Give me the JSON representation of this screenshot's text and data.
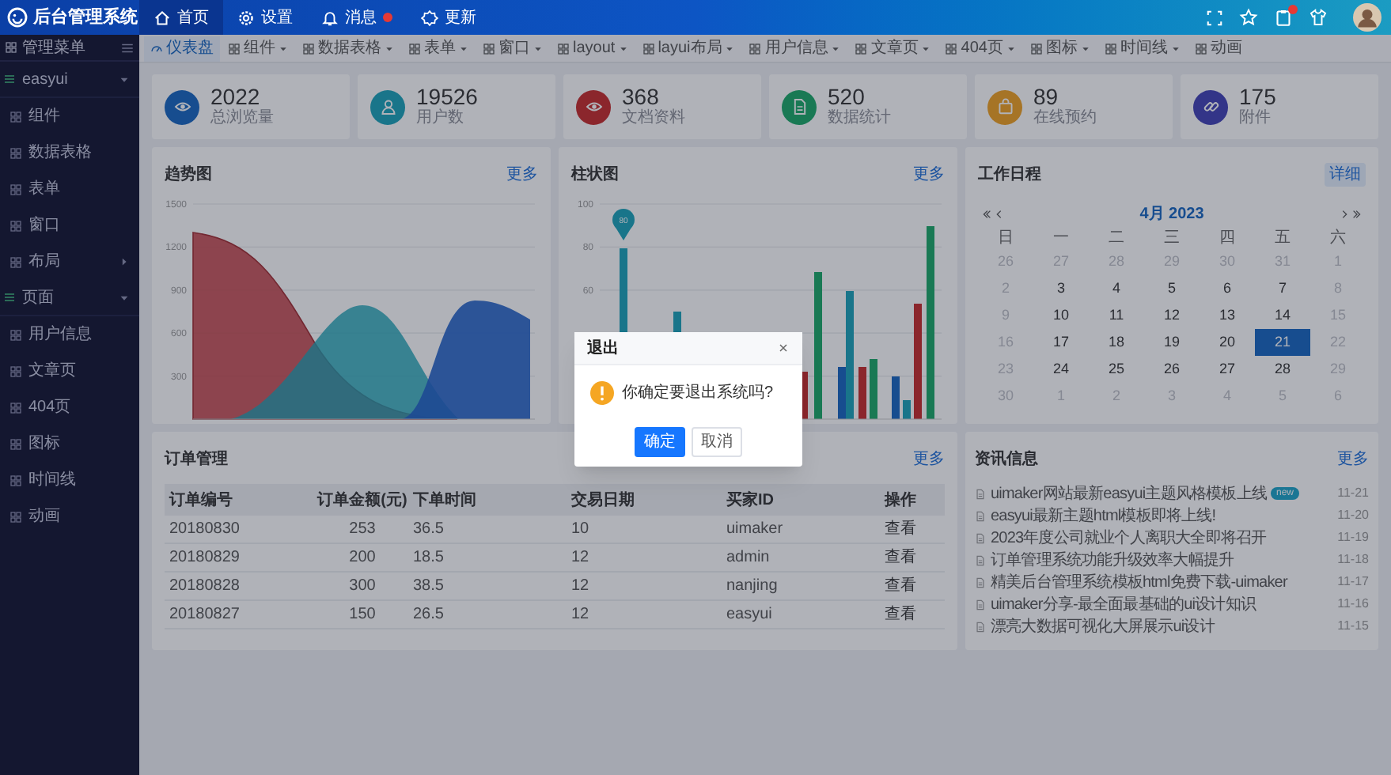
{
  "top_bar": {
    "title": "后台管理系统",
    "nav": [
      {
        "label": "首页",
        "selected": true,
        "badge": false
      },
      {
        "label": "设置",
        "selected": false,
        "badge": false
      },
      {
        "label": "消息",
        "selected": false,
        "badge": true
      },
      {
        "label": "更新",
        "selected": false,
        "badge": false
      }
    ],
    "notification_badge": true
  },
  "sidebar": {
    "title": "管理菜单",
    "items": [
      {
        "label": "easyui",
        "expanded": true,
        "children": [
          {
            "label": "组件"
          },
          {
            "label": "数据表格"
          },
          {
            "label": "表单"
          },
          {
            "label": "窗口"
          },
          {
            "label": "布局",
            "expanded": false
          }
        ]
      },
      {
        "label": "页面",
        "expanded": true,
        "children": [
          {
            "label": "用户信息"
          },
          {
            "label": "文章页"
          },
          {
            "label": "404页"
          },
          {
            "label": "图标"
          },
          {
            "label": "时间线"
          },
          {
            "label": "动画"
          }
        ]
      }
    ]
  },
  "tabs": [
    {
      "label": "仪表盘",
      "selected": true,
      "dropdown": false
    },
    {
      "label": "组件",
      "selected": false,
      "dropdown": true
    },
    {
      "label": "数据表格",
      "selected": false,
      "dropdown": true
    },
    {
      "label": "表单",
      "selected": false,
      "dropdown": true
    },
    {
      "label": "窗口",
      "selected": false,
      "dropdown": true
    },
    {
      "label": "layout",
      "selected": false,
      "dropdown": true
    },
    {
      "label": "layui布局",
      "selected": false,
      "dropdown": true
    },
    {
      "label": "用户信息",
      "selected": false,
      "dropdown": true
    },
    {
      "label": "文章页",
      "selected": false,
      "dropdown": true
    },
    {
      "label": "404页",
      "selected": false,
      "dropdown": true
    },
    {
      "label": "图标",
      "selected": false,
      "dropdown": true
    },
    {
      "label": "时间线",
      "selected": false,
      "dropdown": true
    },
    {
      "label": "动画",
      "selected": false,
      "dropdown": false
    }
  ],
  "stats": [
    {
      "value": "2022",
      "label": "总浏览量"
    },
    {
      "value": "19526",
      "label": "用户数"
    },
    {
      "value": "368",
      "label": "文档资料"
    },
    {
      "value": "520",
      "label": "数据统计"
    },
    {
      "value": "89",
      "label": "在线预约"
    },
    {
      "value": "175",
      "label": "附件"
    }
  ],
  "trend_chart": {
    "title": "趋势图",
    "more": "更多",
    "y_ticks": [
      "1500",
      "1200",
      "900",
      "600",
      "300"
    ]
  },
  "bar_chart": {
    "title": "柱状图",
    "more": "更多",
    "y_ticks": [
      "100",
      "80",
      "60"
    ],
    "pin_label": "80"
  },
  "calendar": {
    "title": "工作日程",
    "detail": "详细",
    "month": "4月 2023",
    "weekdays": [
      "日",
      "一",
      "二",
      "三",
      "四",
      "五",
      "六"
    ],
    "weeks": [
      [
        {
          "day": "26",
          "muted": true,
          "selected": false
        },
        {
          "day": "27",
          "muted": true,
          "selected": false
        },
        {
          "day": "28",
          "muted": true,
          "selected": false
        },
        {
          "day": "29",
          "muted": true,
          "selected": false
        },
        {
          "day": "30",
          "muted": true,
          "selected": false
        },
        {
          "day": "31",
          "muted": true,
          "selected": false
        },
        {
          "day": "1",
          "muted": true,
          "selected": false
        }
      ],
      [
        {
          "day": "2",
          "muted": true,
          "selected": false
        },
        {
          "day": "3",
          "muted": false,
          "selected": false
        },
        {
          "day": "4",
          "muted": false,
          "selected": false
        },
        {
          "day": "5",
          "muted": false,
          "selected": false
        },
        {
          "day": "6",
          "muted": false,
          "selected": false
        },
        {
          "day": "7",
          "muted": false,
          "selected": false
        },
        {
          "day": "8",
          "muted": true,
          "selected": false
        }
      ],
      [
        {
          "day": "9",
          "muted": true,
          "selected": false
        },
        {
          "day": "10",
          "muted": false,
          "selected": false
        },
        {
          "day": "11",
          "muted": false,
          "selected": false
        },
        {
          "day": "12",
          "muted": false,
          "selected": false
        },
        {
          "day": "13",
          "muted": false,
          "selected": false
        },
        {
          "day": "14",
          "muted": false,
          "selected": false
        },
        {
          "day": "15",
          "muted": true,
          "selected": false
        }
      ],
      [
        {
          "day": "16",
          "muted": true,
          "selected": false
        },
        {
          "day": "17",
          "muted": false,
          "selected": false
        },
        {
          "day": "18",
          "muted": false,
          "selected": false
        },
        {
          "day": "19",
          "muted": false,
          "selected": false
        },
        {
          "day": "20",
          "muted": false,
          "selected": false
        },
        {
          "day": "21",
          "muted": false,
          "selected": true
        },
        {
          "day": "22",
          "muted": true,
          "selected": false
        }
      ],
      [
        {
          "day": "23",
          "muted": true,
          "selected": false
        },
        {
          "day": "24",
          "muted": false,
          "selected": false
        },
        {
          "day": "25",
          "muted": false,
          "selected": false
        },
        {
          "day": "26",
          "muted": false,
          "selected": false
        },
        {
          "day": "27",
          "muted": false,
          "selected": false
        },
        {
          "day": "28",
          "muted": false,
          "selected": false
        },
        {
          "day": "29",
          "muted": true,
          "selected": false
        }
      ],
      [
        {
          "day": "30",
          "muted": true,
          "selected": false
        },
        {
          "day": "1",
          "muted": true,
          "selected": false
        },
        {
          "day": "2",
          "muted": true,
          "selected": false
        },
        {
          "day": "3",
          "muted": true,
          "selected": false
        },
        {
          "day": "4",
          "muted": true,
          "selected": false
        },
        {
          "day": "5",
          "muted": true,
          "selected": false
        },
        {
          "day": "6",
          "muted": true,
          "selected": false
        }
      ]
    ]
  },
  "orders": {
    "title": "订单管理",
    "more": "更多",
    "columns": [
      "订单编号",
      "订单金额(元)",
      "下单时间",
      "交易日期",
      "买家ID",
      "操作"
    ],
    "rows": [
      [
        "20180830",
        "253",
        "36.5",
        "10",
        "uimaker",
        "查看"
      ],
      [
        "20180829",
        "200",
        "18.5",
        "12",
        "admin",
        "查看"
      ],
      [
        "20180828",
        "300",
        "38.5",
        "12",
        "nanjing",
        "查看"
      ],
      [
        "20180827",
        "150",
        "26.5",
        "12",
        "easyui",
        "查看"
      ]
    ]
  },
  "news": {
    "title": "资讯信息",
    "more": "更多",
    "items": [
      {
        "title": "uimaker网站最新easyui主题风格模板上线",
        "badge": "new",
        "date": "11-21"
      },
      {
        "title": "easyui最新主题html模板即将上线!",
        "date": "11-20"
      },
      {
        "title": "2023年度公司就业个人离职大全即将召开",
        "date": "11-19"
      },
      {
        "title": "订单管理系统功能升级效率大幅提升",
        "date": "11-18"
      },
      {
        "title": "精美后台管理系统模板html免费下载-uimaker",
        "date": "11-17"
      },
      {
        "title": "uimaker分享-最全面最基础的ui设计知识",
        "date": "11-16"
      },
      {
        "title": "漂亮大数据可视化大屏展示ui设计",
        "date": "11-15"
      }
    ]
  },
  "dialog": {
    "title": "退出",
    "message": "你确定要退出系统吗?",
    "buttons": [
      {
        "label": "确定",
        "kind": "primary"
      },
      {
        "label": "取消",
        "kind": "default"
      }
    ]
  }
}
